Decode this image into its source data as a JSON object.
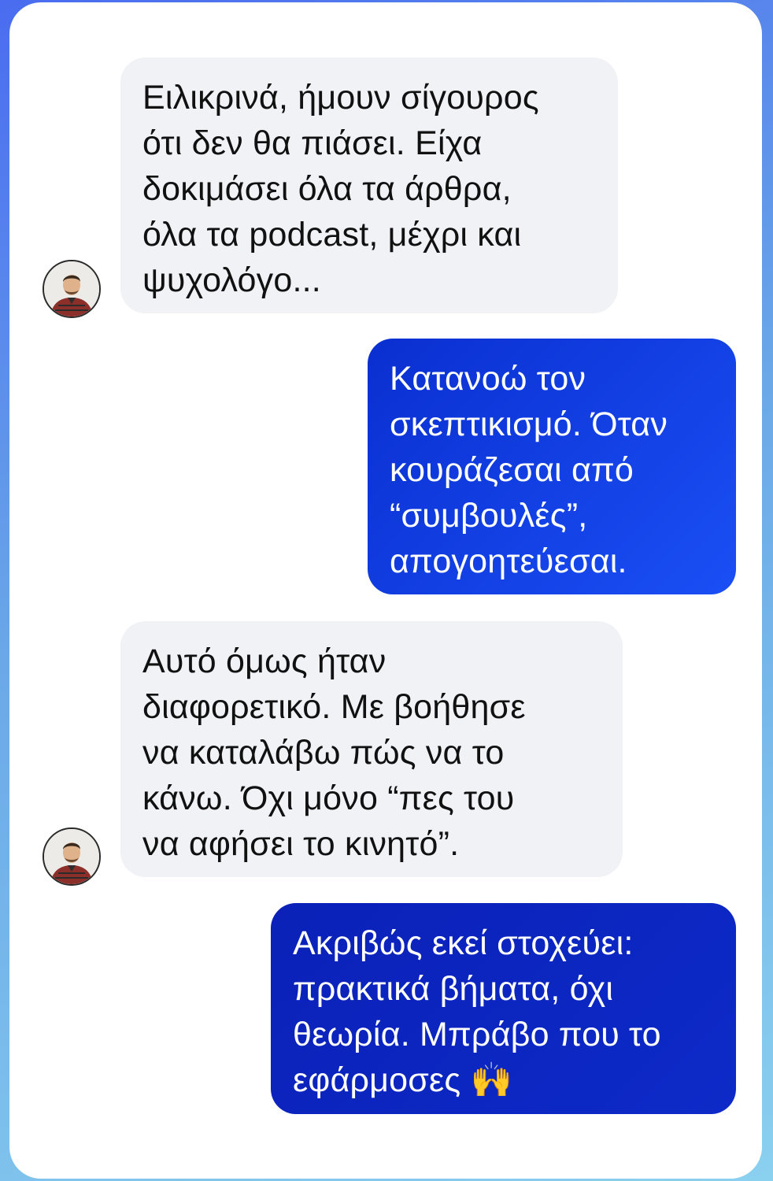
{
  "conversation": {
    "messages": [
      {
        "sender": "contact",
        "lines": [
          "Ειλικρινά, ήμουν σίγουρος",
          "ότι δεν θα πιάσει. Είχα",
          "δοκιμάσει όλα τα άρθρα,",
          "όλα τα podcast, μέχρι και",
          "ψυχολόγο..."
        ]
      },
      {
        "sender": "me",
        "lines": [
          "Κατανοώ τον",
          "σκεπτικισμό. Όταν",
          "κουράζεσαι από",
          "“συμβουλές”,",
          "απογοητεύεσαι."
        ]
      },
      {
        "sender": "contact",
        "lines": [
          "Αυτό όμως ήταν",
          "διαφορετικό. Με βοήθησε",
          "να καταλάβω πώς να το",
          "κάνω. Όχι μόνο “πες του",
          "να αφήσει το κινητό”."
        ]
      },
      {
        "sender": "me",
        "lines": [
          "Ακριβώς εκεί στοχεύει:",
          "πρακτικά βήματα, όχι",
          "θεωρία. Μπράβο που το",
          "εφάρμοσες 🙌"
        ]
      }
    ]
  },
  "colors": {
    "incoming_bg": "#f1f2f6",
    "outgoing_gradient_start": "#0a2fd0",
    "outgoing_gradient_end": "#1a4ff5",
    "outgoing_alt_start": "#0b21b8",
    "outgoing_alt_end": "#0d2ac8"
  }
}
